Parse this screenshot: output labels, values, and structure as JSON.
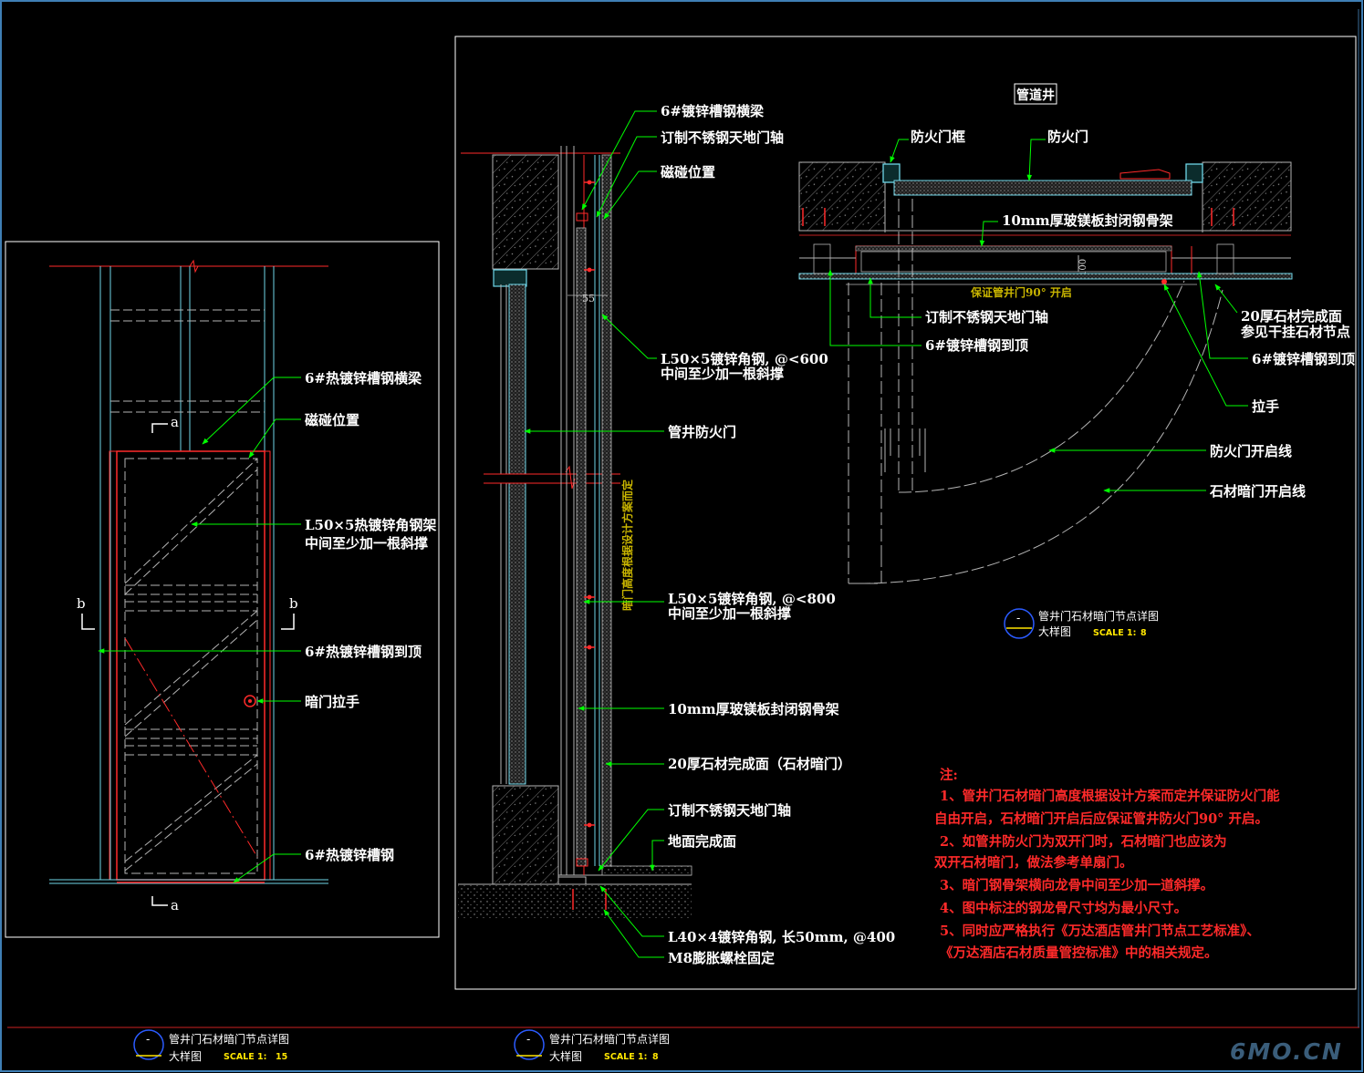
{
  "elevation_labels": {
    "channel_beam": "6#热镀锌槽钢横梁",
    "magnet": "磁碰位置",
    "angle_frame_1": "L50×5热镀锌角钢架",
    "angle_frame_2": "中间至少加一根斜撑",
    "channel_to_top": "6#热镀锌槽钢到顶",
    "handle": "暗门拉手",
    "channel_bottom": "6#热镀锌槽钢",
    "sec_a": "a",
    "sec_b": "b"
  },
  "section_labels": {
    "channel_beam": "6#镀锌槽钢横梁",
    "pivot_top": "订制不锈钢天地门轴",
    "magnet": "磁碰位置",
    "dim_55": "55",
    "angle600_1": "L50×5镀锌角钢, @<600",
    "angle600_2": "中间至少加一根斜撑",
    "fire_door": "管井防火门",
    "vertical_note": "暗门高度根据设计方案而定",
    "angle800_1": "L50×5镀锌角钢, @<800",
    "angle800_2": "中间至少加一根斜撑",
    "mgo_board": "10mm厚玻镁板封闭钢骨架",
    "stone_face": "20厚石材完成面（石材暗门）",
    "pivot_bottom": "订制不锈钢天地门轴",
    "floor": "地面完成面",
    "angle40": "L40×4镀锌角钢, 长50mm, @400",
    "bolt": "M8膨胀螺栓固定"
  },
  "plan_labels": {
    "shaft": "管道井",
    "door_frame": "防火门框",
    "fire_door": "防火门",
    "mgo_board": "10mm厚玻镁板封闭钢骨架",
    "dim_100": "100",
    "open90": "保证管井门90° 开启",
    "pivot": "订制不锈钢天地门轴",
    "channel_top": "6#镀锌槽钢到顶",
    "stone_1": "20厚石材完成面",
    "stone_2": "参见干挂石材节点",
    "channel_top_r": "6#镀锌槽钢到顶",
    "handle": "拉手",
    "fire_swing": "防火门开启线",
    "stone_swing": "石材暗门开启线"
  },
  "notes": {
    "title": "注:",
    "lines": [
      "1、管井门石材暗门高度根据设计方案而定并保证防火门能",
      "自由开启，石材暗门开启后应保证管井防火门90°  开启。",
      "2、如管井防火门为双开门时，石材暗门也应该为",
      "双开石材暗门，做法参考单扇门。",
      "3、暗门钢骨架横向龙骨中间至少加一道斜撑。",
      "4、图中标注的钢龙骨尺寸均为最小尺寸。",
      "5、同时应严格执行《万达酒店管井门节点工艺标准》、",
      "《万达酒店石材质量管控标准》中的相关规定。"
    ]
  },
  "title_blocks": [
    {
      "symbol": "-",
      "title": "管井门石材暗门节点详图",
      "subtitle": "大样图",
      "scale_label": "SCALE 1:",
      "scale_value": "8"
    },
    {
      "symbol": "-",
      "title": "管井门石材暗门节点详图",
      "subtitle": "大样图",
      "scale_label": "SCALE 1:",
      "scale_value": "15"
    },
    {
      "symbol": "-",
      "title": "管井门石材暗门节点详图",
      "subtitle": "大样图",
      "scale_label": "SCALE 1:",
      "scale_value": "8"
    }
  ],
  "watermark": "6MO.CN",
  "colors": {
    "background": "#000000",
    "leader": "#00ff00",
    "label": "#ffffff",
    "note": "#ff2a2a",
    "cyan_line": "#6fd6e8",
    "red_line": "#ff2a2a",
    "hatch": "#8c8c8c",
    "grey_line": "#b4b4b4",
    "frame_border": "#3f7fb5"
  }
}
